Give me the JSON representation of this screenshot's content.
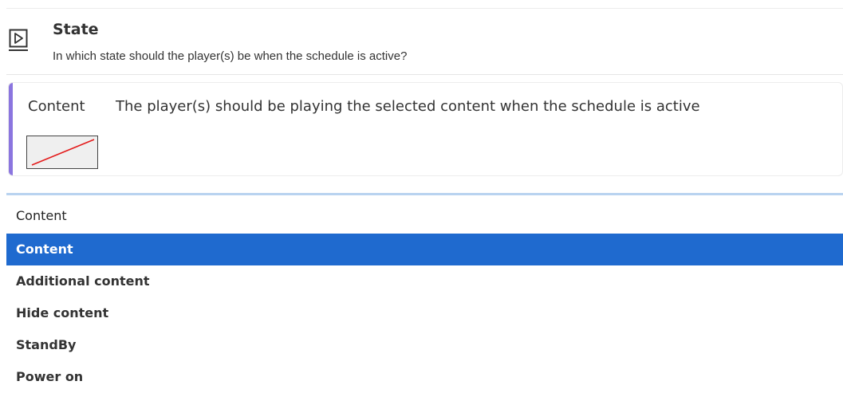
{
  "state": {
    "icon": "play-icon",
    "title": "State",
    "description": "In which state should the player(s) be when the schedule is active?"
  },
  "option_card": {
    "name": "Content",
    "description": "The player(s) should be playing the selected content when the schedule is active",
    "accent_color": "#8b75df",
    "thumbnail_icon": "broken-image-icon"
  },
  "select": {
    "value": "Content",
    "options": [
      {
        "label": "Content",
        "selected": true
      },
      {
        "label": "Additional content",
        "selected": false
      },
      {
        "label": "Hide content",
        "selected": false
      },
      {
        "label": "StandBy",
        "selected": false
      },
      {
        "label": "Power on",
        "selected": false
      }
    ],
    "highlight_color": "#1f6acf"
  }
}
